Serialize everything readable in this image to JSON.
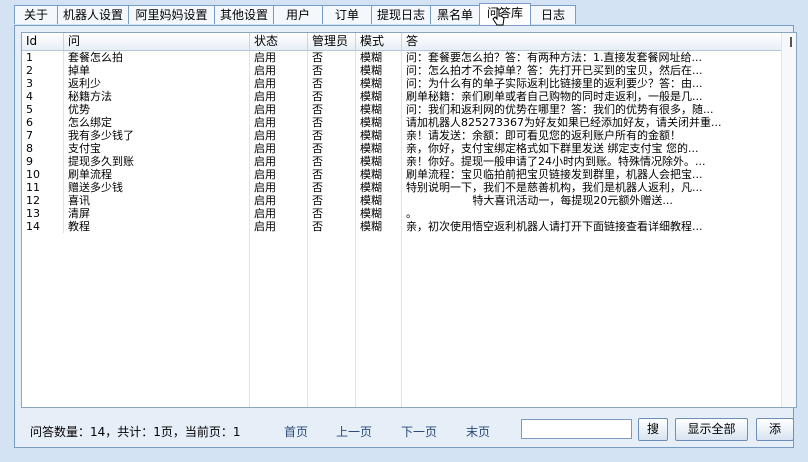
{
  "tabs": [
    "关于",
    "机器人设置",
    "阿里妈妈设置",
    "其他设置",
    "用户",
    "订单",
    "提现日志",
    "黑名单",
    "问答库",
    "日志"
  ],
  "active_tab": "问答库",
  "columns": [
    "Id",
    "问",
    "状态",
    "管理员",
    "模式",
    "答"
  ],
  "rows": [
    [
      "1",
      "套餐怎么拍",
      "启用",
      "否",
      "模糊",
      "问：套餐要怎么拍？答：有两种方法：1.直接发套餐网址给..."
    ],
    [
      "2",
      "掉单",
      "启用",
      "否",
      "模糊",
      "问：怎么拍才不会掉单？答：先打开已买到的宝贝，然后在..."
    ],
    [
      "3",
      "返利少",
      "启用",
      "否",
      "模糊",
      "问：为什么有的单子实际返利比链接里的返利要少？答：由..."
    ],
    [
      "4",
      "秘籍方法",
      "启用",
      "否",
      "模糊",
      "刷单秘籍：亲们刷单或者自己购物的同时走返利，一般是几..."
    ],
    [
      "5",
      "优势",
      "启用",
      "否",
      "模糊",
      "问：我们和返利网的优势在哪里？答：我们的优势有很多，随..."
    ],
    [
      "6",
      "怎么绑定",
      "启用",
      "否",
      "模糊",
      "请加机器人825273367为好友如果已经添加好友，请关闭并重..."
    ],
    [
      "7",
      "我有多少钱了",
      "启用",
      "否",
      "模糊",
      "亲！请发送：余额：即可看见您的返利账户所有的金额！"
    ],
    [
      "8",
      "支付宝",
      "启用",
      "否",
      "模糊",
      "亲，你好，支付宝绑定格式如下群里发送 绑定支付宝 您的..."
    ],
    [
      "9",
      "提现多久到账",
      "启用",
      "否",
      "模糊",
      "亲！你好。提现一般申请了24小时内到账。特殊情况除外。..."
    ],
    [
      "10",
      "刷单流程",
      "启用",
      "否",
      "模糊",
      "刷单流程：宝贝临拍前把宝贝链接发到群里，机器人会把宝..."
    ],
    [
      "11",
      "赠送多少钱",
      "启用",
      "否",
      "模糊",
      "特别说明一下，我们不是慈善机构，我们是机器人返利，凡..."
    ],
    [
      "12",
      "喜讯",
      "启用",
      "否",
      "模糊",
      "                   特大喜讯活动一，每提现20元额外赠送..."
    ],
    [
      "13",
      "清屏",
      "启用",
      "否",
      "模糊",
      "。"
    ],
    [
      "14",
      "教程",
      "启用",
      "否",
      "模糊",
      "亲，初次使用悟空返利机器人请打开下面链接查看详细教程..."
    ]
  ],
  "footer": {
    "status": "问答数量：14，共计：1页，当前页：1",
    "first": "首页",
    "prev": "上一页",
    "next": "下一页",
    "last": "末页",
    "search_value": "",
    "search_button": "搜",
    "show_all_button": "显示全部",
    "add_button": "添"
  },
  "colors": {
    "accent": "#7a9cc4",
    "background": "#d4e3f3"
  }
}
